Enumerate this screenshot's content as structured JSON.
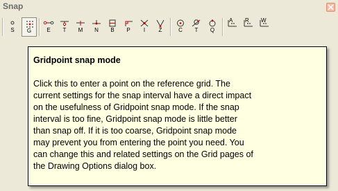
{
  "window": {
    "title": "Snap"
  },
  "toolbar": {
    "buttons": [
      {
        "name": "snap-off",
        "letter": "S"
      },
      {
        "name": "gridpoint",
        "letter": "G",
        "active": true
      },
      {
        "name": "endpoint",
        "letter": "E"
      },
      {
        "name": "edge",
        "letter": "T"
      },
      {
        "name": "midpoint",
        "letter": "M"
      },
      {
        "name": "nearest",
        "letter": "N"
      },
      {
        "name": "bisector",
        "letter": "B"
      },
      {
        "name": "perpendicular",
        "letter": "P"
      },
      {
        "name": "intersection",
        "letter": "I"
      },
      {
        "name": "angle-z",
        "letter": "Z"
      },
      {
        "name": "center",
        "letter": "C"
      },
      {
        "name": "tangent",
        "letter": "T"
      },
      {
        "name": "quadrant",
        "letter": "Q"
      },
      {
        "name": "absolute-axes",
        "letter": "A"
      },
      {
        "name": "relative-axes",
        "letter": "R"
      },
      {
        "name": "working-axes",
        "letter": "W"
      }
    ]
  },
  "tooltip": {
    "title": "Gridpoint snap mode",
    "lines": [
      "Click this to enter a point on the reference grid. The",
      "current settings for the snap interval have a direct impact",
      "on the usefulness of Gridpoint snap mode. If the snap",
      "interval is too fine, Gridpoint snap mode is little better",
      "than snap off. If it is too coarse, Gridpoint snap mode",
      "may prevent you from entering the point you need. You",
      "can change this and related settings on the Grid pages of",
      "the Drawing Options dialog box."
    ]
  }
}
